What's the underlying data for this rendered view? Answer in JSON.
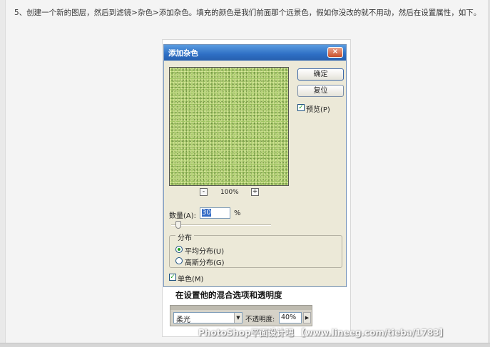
{
  "article": {
    "text": "5、创建一个新的图层，然后到滤镜>杂色>添加杂色。填充的颜色是我们前面那个远景色，假如你没改的就不用动，然后在设置属性，如下。"
  },
  "dialog": {
    "title": "添加杂色",
    "close_symbol": "×",
    "ok_label": "确定",
    "reset_label": "复位",
    "preview_label": "预览(P)",
    "preview_checked": true,
    "zoom_out_symbol": "-",
    "zoom_in_symbol": "+",
    "zoom_level": "100%",
    "amount_label": "数量(A):",
    "amount_value": "30",
    "amount_unit": "%",
    "distribution_title": "分布",
    "uniform_label": "平均分布(U)",
    "gaussian_label": "高斯分布(G)",
    "selected_distribution": "uniform",
    "monochrome_label": "单色(M)",
    "monochrome_checked": true,
    "check_mark": "✓"
  },
  "caption": "在设置他的混合选项和透明度",
  "layers": {
    "blend_mode": "柔光",
    "opacity_label": "不透明度:",
    "opacity_value": "40%"
  },
  "watermark": "PhotoShop平面设计吧 【www.lineeg.com/tieba/1783】"
}
